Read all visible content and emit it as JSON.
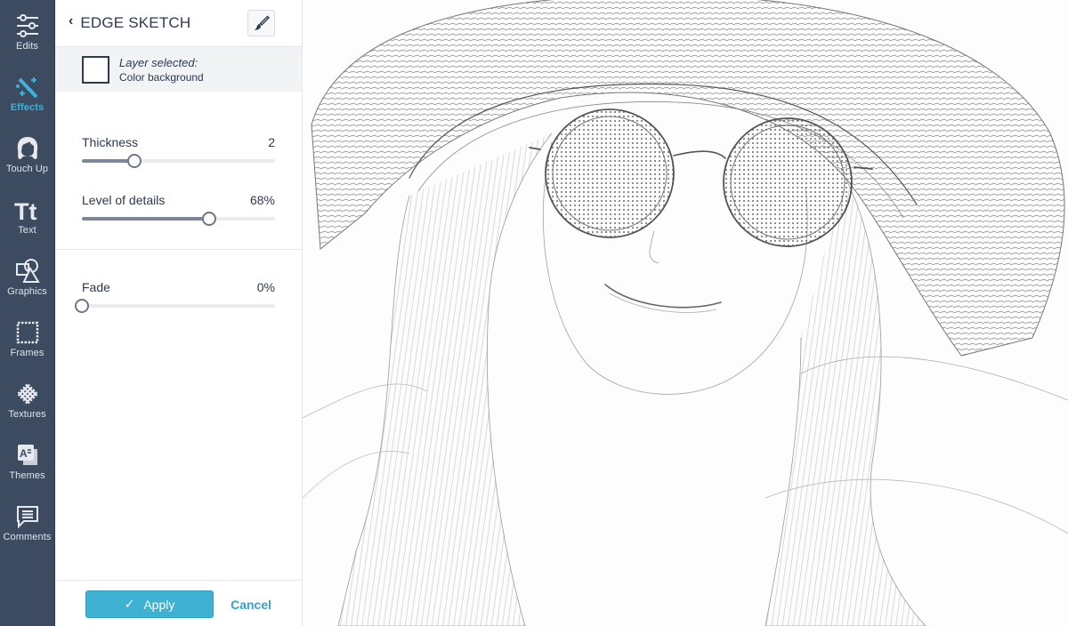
{
  "nav": {
    "items": [
      {
        "label": "Edits",
        "icon": "sliders-icon",
        "active": false
      },
      {
        "label": "Effects",
        "icon": "magic-wand-icon",
        "active": true
      },
      {
        "label": "Touch Up",
        "icon": "face-icon",
        "active": false
      },
      {
        "label": "Text",
        "icon": "text-icon",
        "active": false
      },
      {
        "label": "Graphics",
        "icon": "shapes-icon",
        "active": false
      },
      {
        "label": "Frames",
        "icon": "frame-icon",
        "active": false
      },
      {
        "label": "Textures",
        "icon": "texture-icon",
        "active": false
      },
      {
        "label": "Themes",
        "icon": "themes-icon",
        "active": false
      },
      {
        "label": "Comments",
        "icon": "comment-icon",
        "active": false
      }
    ],
    "accent_color": "#3fb2d8"
  },
  "panel": {
    "title": "EDGE SKETCH",
    "back_icon": "chevron-left-icon",
    "brush_icon": "paintbrush-icon",
    "layer": {
      "label": "Layer selected:",
      "value": "Color background"
    },
    "sliders": [
      {
        "label": "Thickness",
        "display": "2",
        "fraction": 0.27
      },
      {
        "label": "Level of details",
        "display": "68%",
        "fraction": 0.66
      },
      {
        "label": "Fade",
        "display": "0%",
        "fraction": 0.0
      }
    ],
    "apply_label": "Apply",
    "cancel_label": "Cancel"
  },
  "canvas": {
    "description": "Edge sketch effect applied to a photo of a woman wearing a straw hat and round sunglasses"
  }
}
